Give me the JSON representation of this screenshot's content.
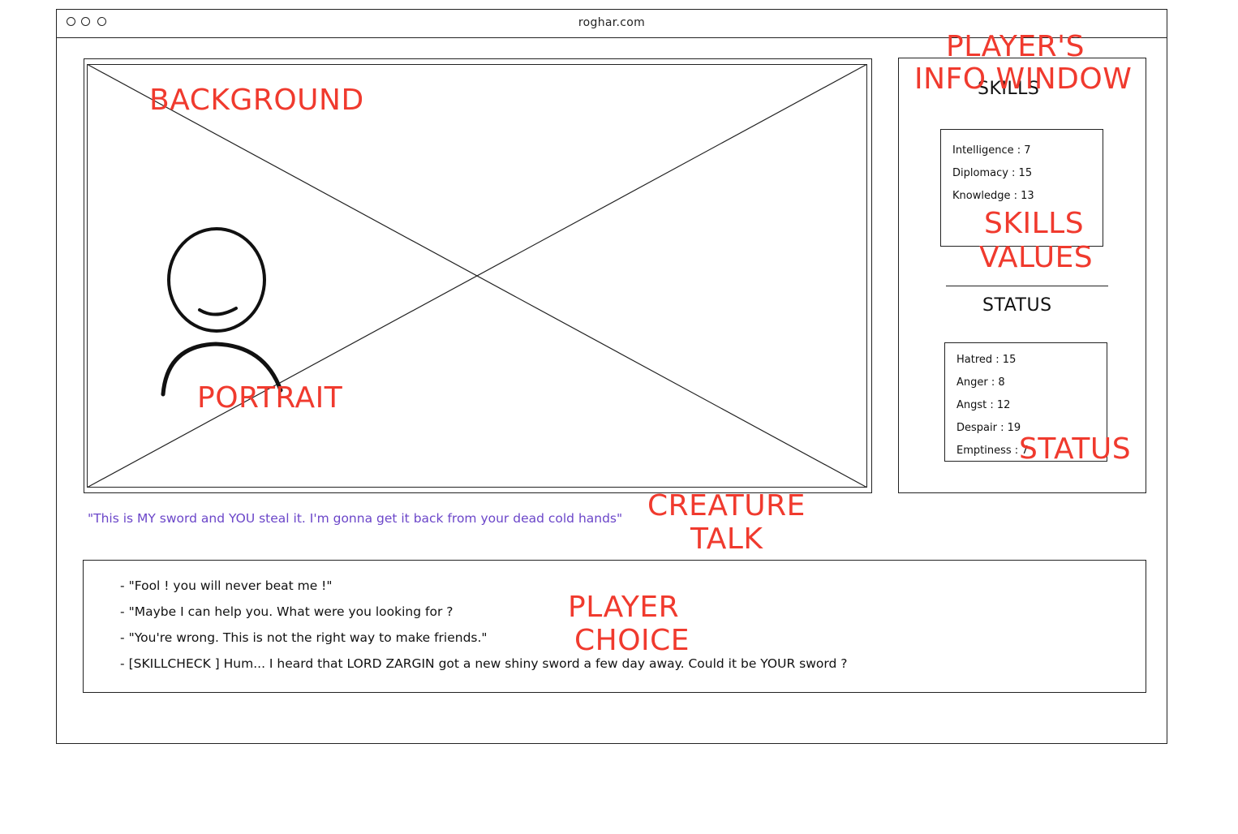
{
  "browser": {
    "url": "roghar.com"
  },
  "annotations": {
    "background": "BACKGROUND",
    "portrait": "PORTRAIT",
    "players_info_window_1": "PLAYER'S",
    "players_info_window_2": "INFO WINDOW",
    "skills_values_1": "SKILLS",
    "skills_values_2": "VALUES",
    "status": "STATUS",
    "creature_talk_1": "CREATURE",
    "creature_talk_2": "TALK",
    "player_choice_1": "PLAYER",
    "player_choice_2": "CHOICE"
  },
  "info_window": {
    "skills_heading": "SKILLS",
    "skills": [
      "Intelligence : 7",
      "Diplomacy : 15",
      "Knowledge : 13"
    ],
    "status_heading": "STATUS",
    "status": [
      "Hatred : 15",
      "Anger : 8",
      "Angst : 12",
      "Despair : 19",
      "Emptiness : 7"
    ]
  },
  "creature_talk": "\"This is MY sword and YOU steal it. I'm gonna get it back from your dead cold hands\"",
  "player_choices": {
    "dash": "-",
    "items": [
      "\"Fool ! you will never beat me !\"",
      "\"Maybe I can help you. What were you looking for ?",
      "\"You're wrong. This is not the right way to make friends.\"",
      "[SKILLCHECK ] Hum... I heard that LORD ZARGIN got a new shiny sword a few day away. Could it be YOUR sword ?"
    ]
  },
  "colors": {
    "annotation": "#f03a2e",
    "creature_talk": "#6b46c9",
    "line": "#222222"
  }
}
